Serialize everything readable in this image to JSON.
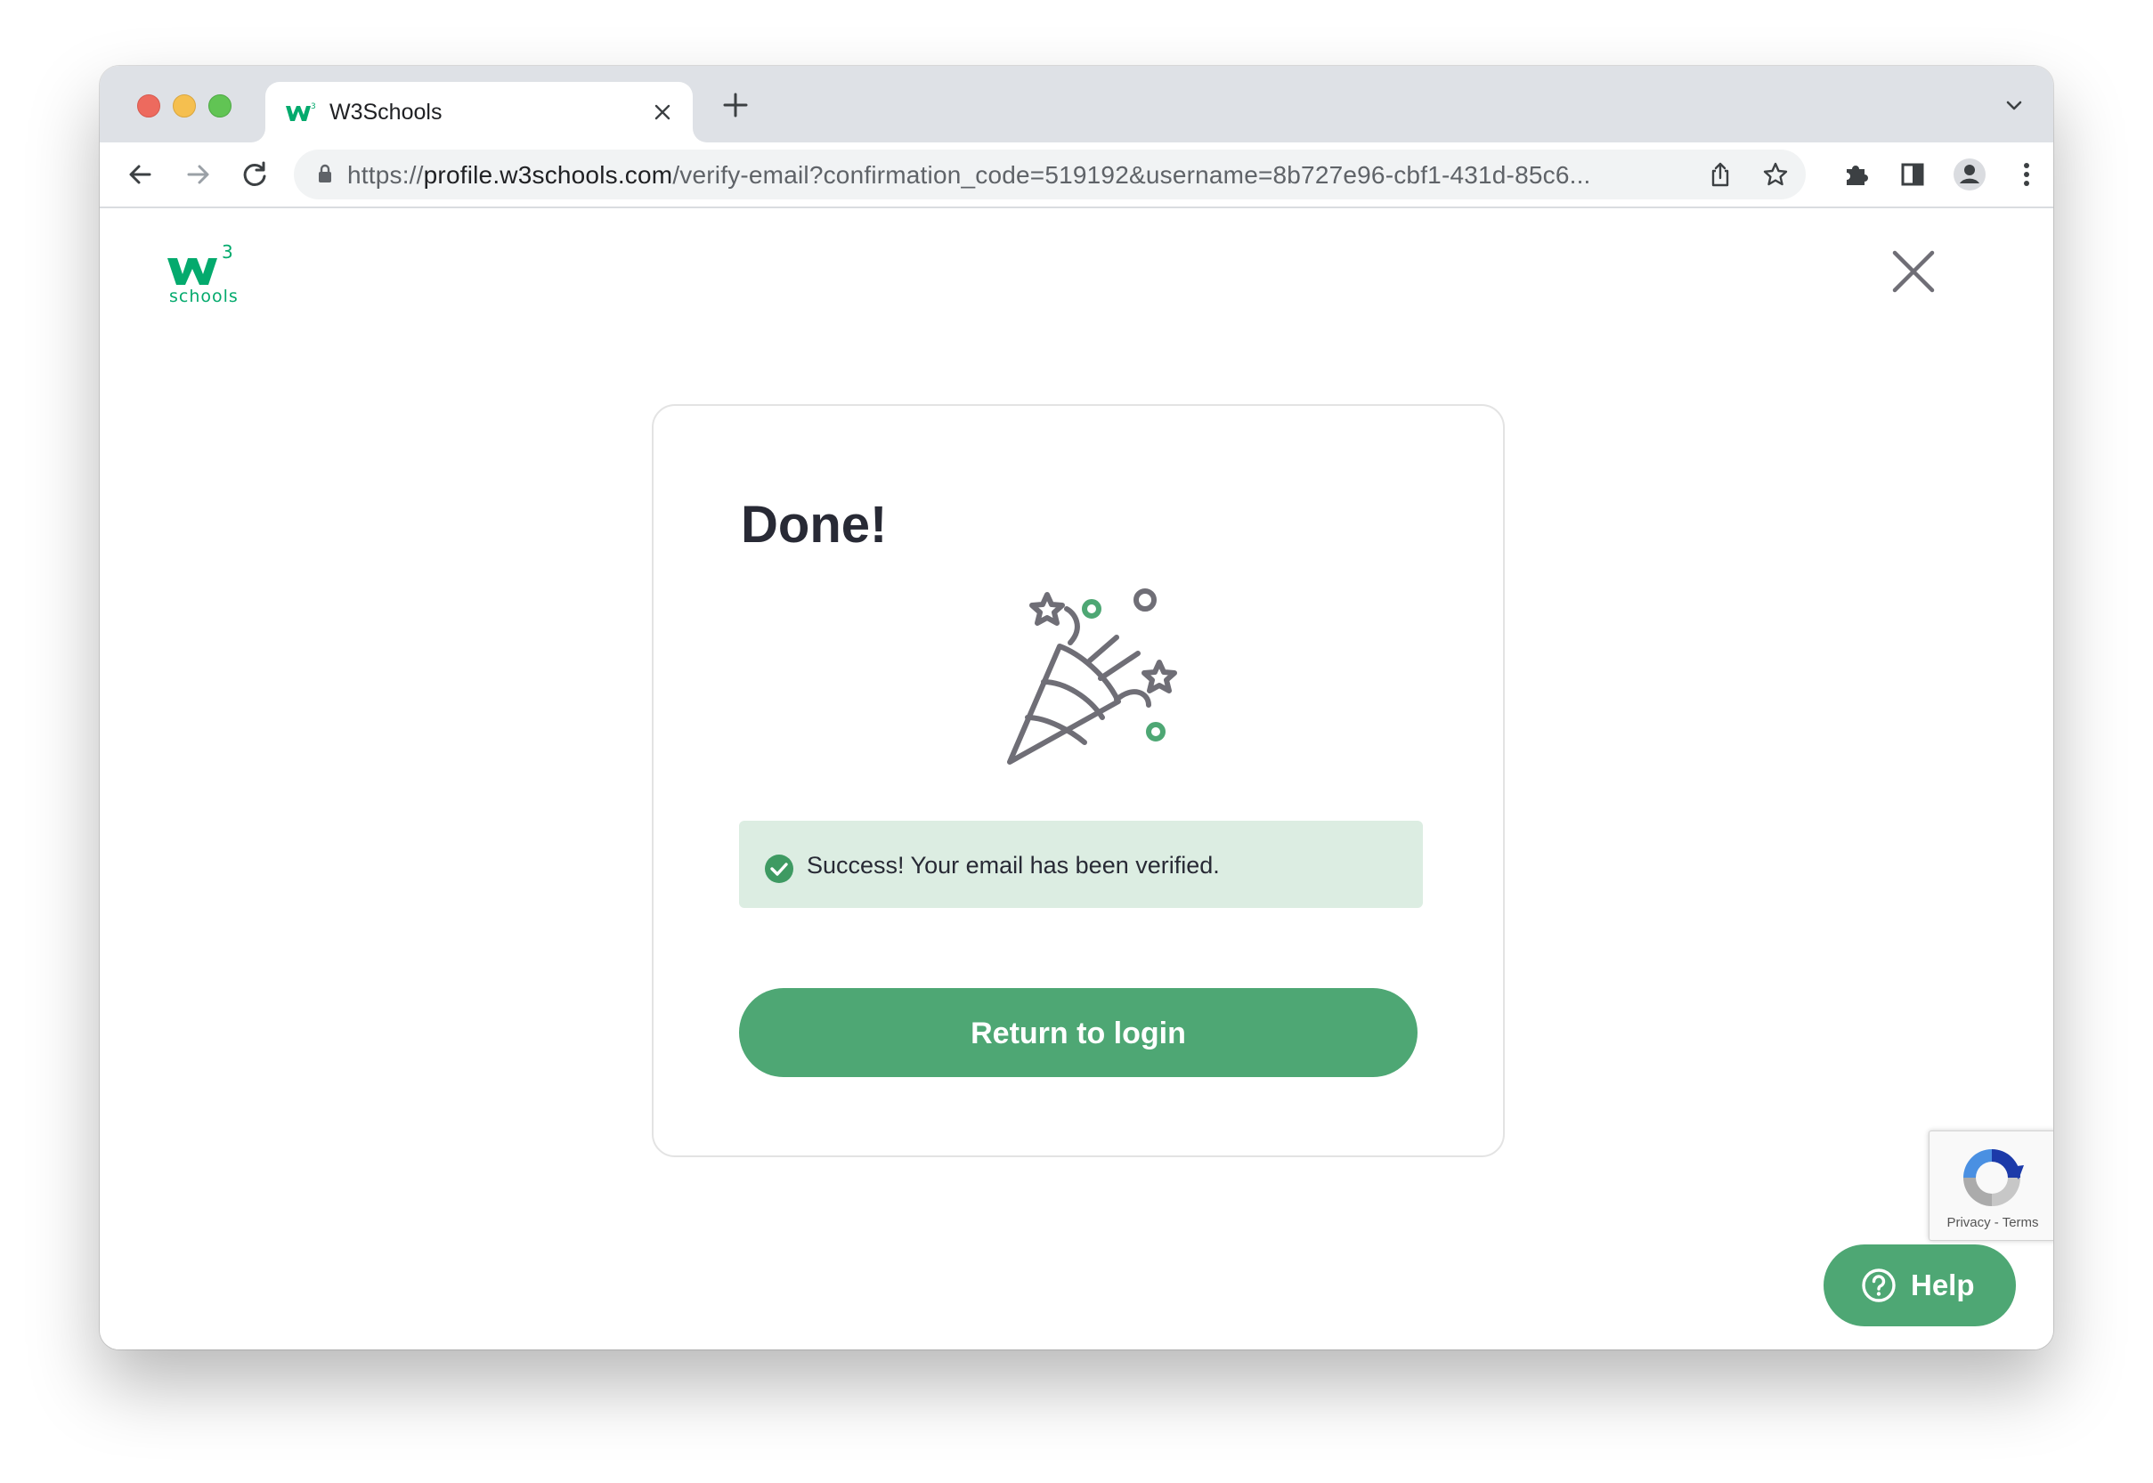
{
  "browser": {
    "tab_title": "W3Schools",
    "url_scheme": "https://",
    "url_host": "profile.w3schools.com",
    "url_path": "/verify-email?confirmation_code=519192&username=8b727e96-cbf1-431d-85c6..."
  },
  "page": {
    "logo_text": "schools",
    "card_title": "Done!",
    "alert_message": "Success! Your email has been verified.",
    "return_button_label": "Return to login",
    "help_label": "Help",
    "recaptcha_privacy": "Privacy",
    "recaptcha_separator": " - ",
    "recaptcha_terms": "Terms"
  },
  "colors": {
    "brand_green": "#04aa6d",
    "button_green": "#4ea774",
    "alert_background": "#dcede2",
    "icon_gray": "#6f6e76"
  },
  "icons": [
    "w3schools-favicon",
    "close-tab-icon",
    "new-tab-icon",
    "tab-dropdown-icon",
    "back-icon",
    "forward-icon",
    "reload-icon",
    "lock-icon",
    "share-icon",
    "bookmark-star-icon",
    "extensions-icon",
    "side-panel-icon",
    "profile-icon",
    "menu-icon",
    "w3schools-logo",
    "close-icon",
    "party-popper-icon",
    "check-circle-icon",
    "recaptcha-icon",
    "help-icon"
  ]
}
